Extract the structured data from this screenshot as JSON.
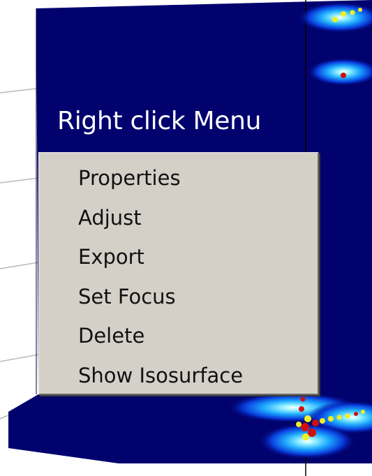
{
  "menu_title": "Right click Menu",
  "context_menu": {
    "items": [
      {
        "label": "Properties"
      },
      {
        "label": "Adjust"
      },
      {
        "label": "Export"
      },
      {
        "label": "Set Focus"
      },
      {
        "label": "Delete"
      },
      {
        "label": "Show Isosurface"
      }
    ]
  },
  "colors": {
    "viewport_background": "#02026e",
    "menu_background": "#d4d0c8",
    "isosurface_glow": "#48c8ff",
    "marker_red": "#d01010",
    "marker_yellow": "#f0f020"
  }
}
